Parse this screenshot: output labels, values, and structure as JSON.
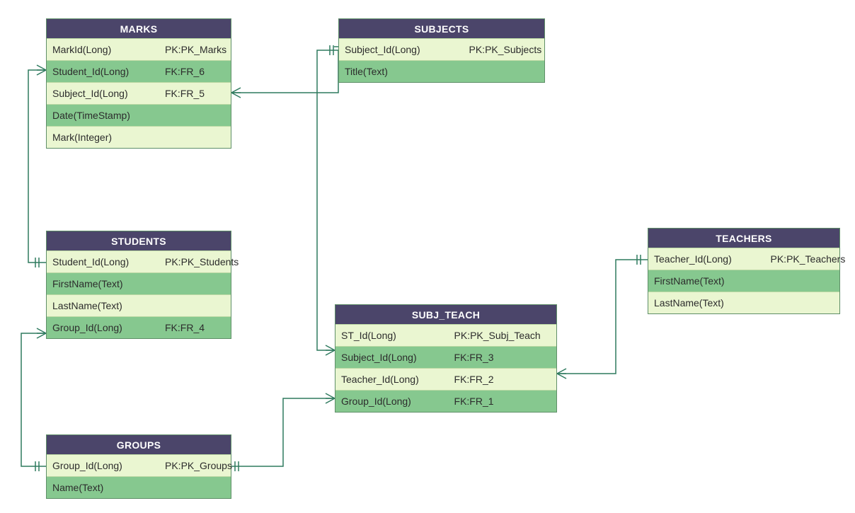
{
  "colors": {
    "header": "#4b456a",
    "rowDark": "#86c88f",
    "rowLight": "#eaf6d1",
    "line": "#2f7a5f"
  },
  "entities": {
    "marks": {
      "title": "MARKS",
      "rows": [
        {
          "name": "MarkId(Long)",
          "key": "PK:PK_Marks"
        },
        {
          "name": "Student_Id(Long)",
          "key": "FK:FR_6"
        },
        {
          "name": "Subject_Id(Long)",
          "key": "FK:FR_5"
        },
        {
          "name": "Date(TimeStamp)",
          "key": ""
        },
        {
          "name": "Mark(Integer)",
          "key": ""
        }
      ]
    },
    "subjects": {
      "title": "SUBJECTS",
      "rows": [
        {
          "name": "Subject_Id(Long)",
          "key": "PK:PK_Subjects"
        },
        {
          "name": "Title(Text)",
          "key": ""
        }
      ]
    },
    "students": {
      "title": "STUDENTS",
      "rows": [
        {
          "name": "Student_Id(Long)",
          "key": "PK:PK_Students"
        },
        {
          "name": "FirstName(Text)",
          "key": ""
        },
        {
          "name": "LastName(Text)",
          "key": ""
        },
        {
          "name": "Group_Id(Long)",
          "key": "FK:FR_4"
        }
      ]
    },
    "subj_teach": {
      "title": "SUBJ_TEACH",
      "rows": [
        {
          "name": "ST_Id(Long)",
          "key": "PK:PK_Subj_Teach"
        },
        {
          "name": "Subject_Id(Long)",
          "key": "FK:FR_3"
        },
        {
          "name": "Teacher_Id(Long)",
          "key": "FK:FR_2"
        },
        {
          "name": "Group_Id(Long)",
          "key": "FK:FR_1"
        }
      ]
    },
    "teachers": {
      "title": "TEACHERS",
      "rows": [
        {
          "name": "Teacher_Id(Long)",
          "key": "PK:PK_Teachers"
        },
        {
          "name": "FirstName(Text)",
          "key": ""
        },
        {
          "name": "LastName(Text)",
          "key": ""
        }
      ]
    },
    "groups": {
      "title": "GROUPS",
      "rows": [
        {
          "name": "Group_Id(Long)",
          "key": "PK:PK_Groups"
        },
        {
          "name": "Name(Text)",
          "key": ""
        }
      ]
    }
  }
}
